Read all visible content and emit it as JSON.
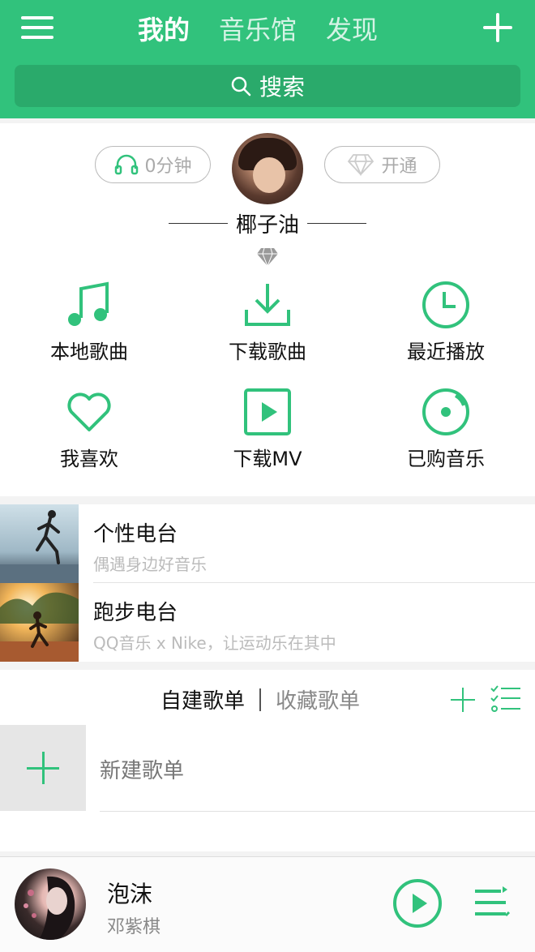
{
  "header": {
    "tabs": [
      {
        "label": "我的",
        "active": true
      },
      {
        "label": "音乐馆",
        "active": false
      },
      {
        "label": "发现",
        "active": false
      }
    ],
    "search_label": "搜索"
  },
  "profile": {
    "listen_time": "0分钟",
    "vip_label": "开通",
    "username": "椰子油"
  },
  "grid": [
    {
      "label": "本地歌曲",
      "icon": "music-note-icon"
    },
    {
      "label": "下载歌曲",
      "icon": "download-icon"
    },
    {
      "label": "最近播放",
      "icon": "clock-icon"
    },
    {
      "label": "我喜欢",
      "icon": "heart-icon"
    },
    {
      "label": "下载MV",
      "icon": "video-play-icon"
    },
    {
      "label": "已购音乐",
      "icon": "disc-icon"
    }
  ],
  "radio": [
    {
      "title": "个性电台",
      "subtitle": "偶遇身边好音乐"
    },
    {
      "title": "跑步电台",
      "subtitle": "QQ音乐 x Nike，让运动乐在其中"
    }
  ],
  "playlists": {
    "tab_created": "自建歌单",
    "tab_favorited": "收藏歌单",
    "new_label": "新建歌单"
  },
  "player": {
    "title": "泡沫",
    "artist": "邓紫棋"
  },
  "colors": {
    "accent": "#31c27c",
    "header_dark": "#2aaa6b"
  }
}
